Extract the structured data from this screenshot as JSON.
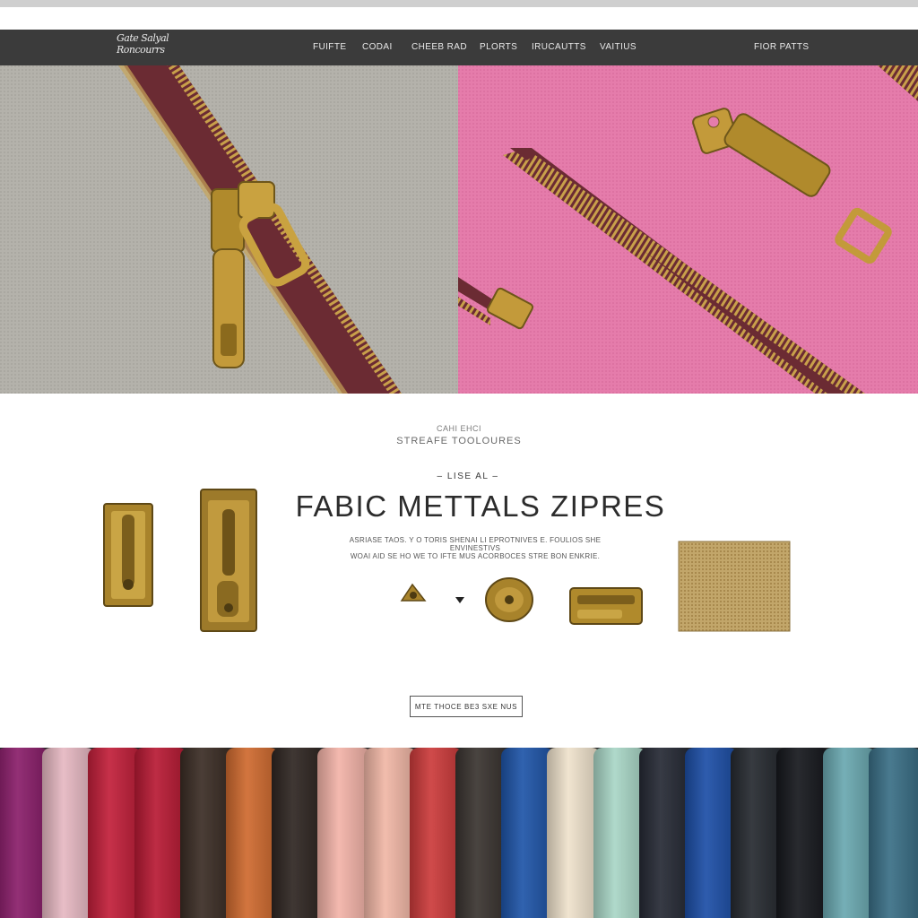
{
  "nav": {
    "logo_line1": "Gate Salyal",
    "logo_line2": "Roncourrs",
    "links": [
      "FUIFTE",
      "CODAI",
      "CHEEB RAD",
      "PLORTS",
      "IRUCAUTTS",
      "VAITIUS"
    ],
    "right_link": "FIOR PATTS"
  },
  "hero": {
    "left_color": "#b4b2ab",
    "right_color": "#e57cab",
    "zipper_tape_color": "#6b2b33",
    "metal_color": "#b08a2c"
  },
  "section": {
    "kicker": "CAHI EHCI",
    "subtitle": "STREAFE TOOLOURES",
    "tag": "– LISE AL –",
    "title": "FABIC METTALS ZIPRES",
    "description_line1": "ASRIASE TAOS. Y O TORIS SHENAI LI EPROTNIVES E. FOULIOS SHE ENVINESTIVS",
    "description_line2": "WOAI AID SE HO WE TO IFTE MUS ACORBOCES STRE BON ENKRIE.",
    "cta_label": "MTE THOCE BE3 SXE NUS"
  },
  "items": [
    {
      "name": "zipper-puller-small"
    },
    {
      "name": "zipper-puller-large"
    },
    {
      "name": "zipper-stopper"
    },
    {
      "name": "snap-button"
    },
    {
      "name": "zipper-slider"
    },
    {
      "name": "metal-mesh-patch"
    }
  ],
  "swatches": [
    {
      "color": "#8a1e6a"
    },
    {
      "color": "#e6b8c2"
    },
    {
      "color": "#c21f3a"
    },
    {
      "color": "#b81a34"
    },
    {
      "color": "#3b2d25"
    },
    {
      "color": "#cf6a2f"
    },
    {
      "color": "#2f2622"
    },
    {
      "color": "#f3b3a8"
    },
    {
      "color": "#f1b7a6"
    },
    {
      "color": "#cc3b3b"
    },
    {
      "color": "#3a3430"
    },
    {
      "color": "#1f55a8"
    },
    {
      "color": "#efe2cc"
    },
    {
      "color": "#a9d6c6"
    },
    {
      "color": "#262a35"
    },
    {
      "color": "#1d4fa7"
    },
    {
      "color": "#262a30"
    },
    {
      "color": "#16181d"
    },
    {
      "color": "#6aa8b0"
    },
    {
      "color": "#3a6f86"
    }
  ]
}
